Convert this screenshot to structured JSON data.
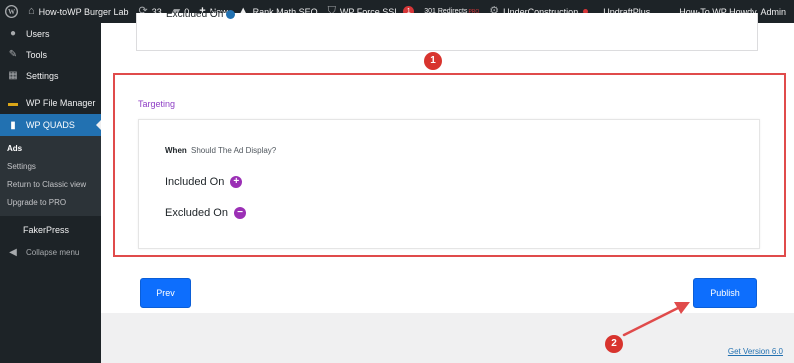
{
  "adminbar": {
    "site_name": "How-toWP Burger Lab",
    "updates_count": "33",
    "comments_count": "0",
    "new_label": "New",
    "rankmath_label": "Rank Math SEO",
    "forcessl_label": "WP Force SSL",
    "forcessl_badge": "1",
    "redirects_label": "301 Redirects",
    "redirects_pro": "PRO",
    "underconstruction_label": "UnderConstruction",
    "updraft_label": "UpdraftPlus",
    "howdy_label": "How-To WP Howdy, Admin"
  },
  "sidebar": {
    "items": [
      {
        "label": "Users",
        "icon": "users-icon"
      },
      {
        "label": "Tools",
        "icon": "tools-icon"
      },
      {
        "label": "Settings",
        "icon": "settings-icon"
      },
      {
        "label": "WP File Manager",
        "icon": "file-manager-icon"
      },
      {
        "label": "WP QUADS",
        "icon": "quads-icon"
      }
    ],
    "submenu": [
      "Ads",
      "Settings",
      "Return to Classic view",
      "Upgrade to PRO"
    ],
    "fakerpress_label": "FakerPress",
    "collapse_label": "Collapse menu"
  },
  "main": {
    "top_card_label": "Excluded On",
    "targeting_title": "Targeting",
    "when_bold": "When",
    "when_rest": "Should The Ad Display?",
    "included_label": "Included On",
    "excluded_label": "Excluded On",
    "prev_label": "Prev",
    "publish_label": "Publish",
    "version_link": "Get Version 6.0"
  },
  "annotations": {
    "callout_1": "1",
    "callout_2": "2"
  },
  "colors": {
    "admin_dark": "#1d2327",
    "wp_blue": "#2271b1",
    "button_blue": "#0d6efd",
    "purple": "#9b2fb5",
    "annotation_red": "#e04b4b"
  }
}
